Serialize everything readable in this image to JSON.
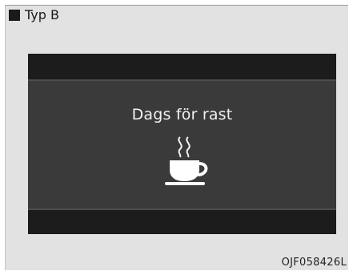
{
  "header": {
    "title": "Typ B"
  },
  "display": {
    "message": "Dags för rast",
    "icon": "coffee-cup-icon"
  },
  "footer": {
    "image_code": "OJF058426L"
  },
  "colors": {
    "panel_background": "#e2e2e2",
    "display_background": "#3a3a3a",
    "display_bar": "#1c1c1c",
    "display_text": "#f2f2f2"
  }
}
